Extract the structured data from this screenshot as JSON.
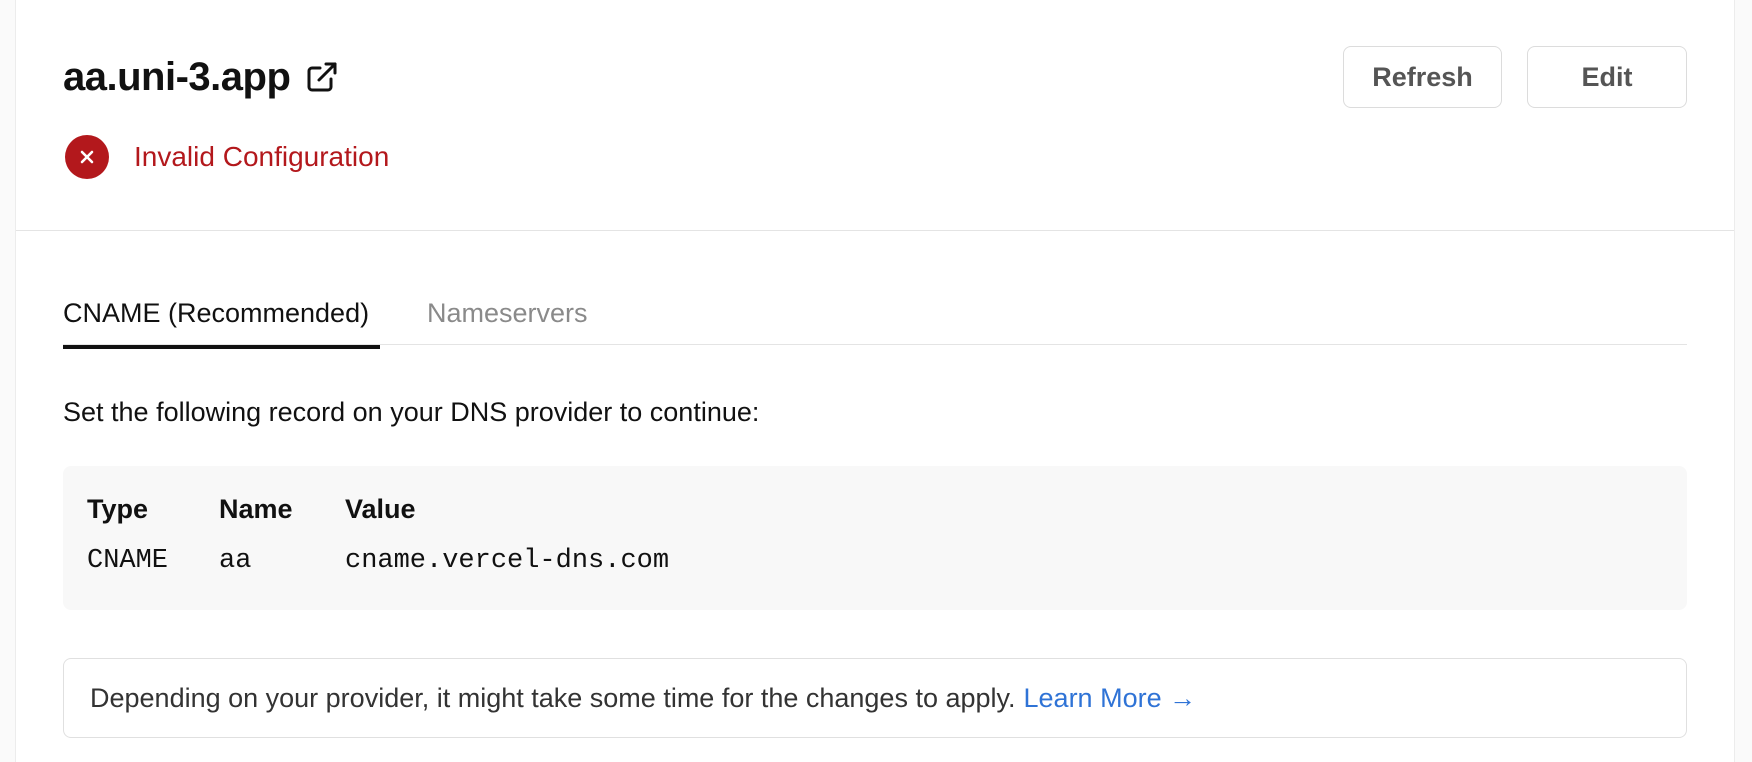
{
  "domain": {
    "name": "aa.uni-3.app",
    "external_link_icon": "external-link-icon"
  },
  "actions": {
    "refresh_label": "Refresh",
    "edit_label": "Edit"
  },
  "status": {
    "icon": "error-x-icon",
    "text": "Invalid Configuration",
    "color": "#b3181c"
  },
  "tabs": [
    {
      "label": "CNAME (Recommended)",
      "active": true
    },
    {
      "label": "Nameservers",
      "active": false
    }
  ],
  "instruction": "Set the following record on your DNS provider to continue:",
  "record": {
    "headers": [
      "Type",
      "Name",
      "Value"
    ],
    "values": [
      "CNAME",
      "aa",
      "cname.vercel-dns.com"
    ]
  },
  "note": {
    "text": "Depending on your provider, it might take some time for the changes to apply.",
    "link_label": "Learn More →",
    "link_color": "#2f73d6"
  }
}
